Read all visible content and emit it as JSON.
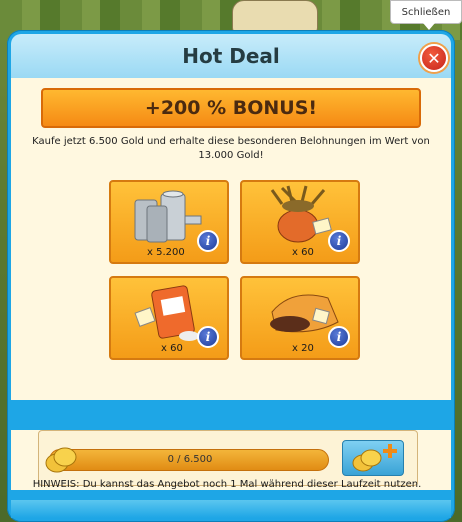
{
  "tooltip": {
    "label": "Schließen"
  },
  "dialog": {
    "title": "Hot Deal",
    "bonus_label": "+200 % BONUS!",
    "description": "Kaufe jetzt 6.500 Gold und erhalte diese besonderen Belohnungen im Wert von 13.000 Gold!",
    "rewards": [
      {
        "item": "milk-cans",
        "quantity": "x 5.200"
      },
      {
        "item": "hay-bundle-sack",
        "quantity": "x 60"
      },
      {
        "item": "fertilizer-bag",
        "quantity": "x 60"
      },
      {
        "item": "soil-sack",
        "quantity": "x 20"
      }
    ],
    "progress": {
      "text": "0 / 6.500",
      "current": 0,
      "max": 6500
    },
    "hint": "HINWEIS: Du kannst das Angebot noch 1 Mal während dieser Laufzeit nutzen."
  },
  "colors": {
    "accent_orange": "#f58a14",
    "dialog_blue": "#1ea6e6",
    "panel_cream": "#fff8e0",
    "close_red": "#c6241b"
  }
}
